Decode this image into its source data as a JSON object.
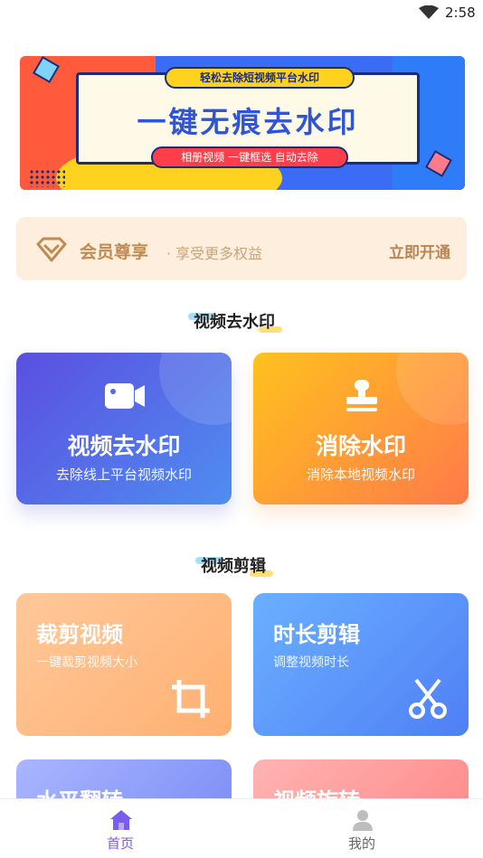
{
  "status_bar": {
    "time": "2:58"
  },
  "banner": {
    "top_tag": "轻松去除短视频平台水印",
    "headline": "一键无痕去水印",
    "bottom_tag": "相册视频 一键框选 自动去除"
  },
  "vip": {
    "title": "会员尊享",
    "subtitle": "· 享受更多权益",
    "action": "立即开通"
  },
  "section1": {
    "title": "视频去水印"
  },
  "card_remove_online": {
    "label": "视频去水印",
    "desc": "去除线上平台视频水印",
    "icon": "video-camera-icon"
  },
  "card_remove_local": {
    "label": "消除水印",
    "desc": "消除本地视频水印",
    "icon": "stamp-icon"
  },
  "section2": {
    "title": "视频剪辑"
  },
  "card_crop": {
    "label": "裁剪视频",
    "desc": "一键裁剪视频大小",
    "icon": "crop-icon"
  },
  "card_trim": {
    "label": "时长剪辑",
    "desc": "调整视频时长",
    "icon": "scissors-icon"
  },
  "card_flip": {
    "label": "水平翻转"
  },
  "card_rotate": {
    "label": "视频旋转"
  },
  "tabbar": {
    "home": {
      "label": "首页",
      "icon": "home-icon"
    },
    "mine": {
      "label": "我的",
      "icon": "user-icon"
    }
  },
  "colors": {
    "accent": "#7b5cf0",
    "vip_gold": "#c08b52",
    "tab_inactive": "#666666"
  }
}
